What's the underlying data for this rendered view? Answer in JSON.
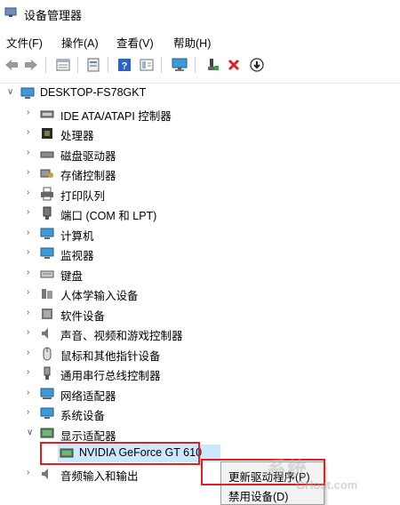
{
  "window": {
    "title": "设备管理器"
  },
  "menu": [
    "文件(F)",
    "操作(A)",
    "查看(V)",
    "帮助(H)"
  ],
  "toolbar_icons": [
    "back-arrow-icon",
    "forward-arrow-icon",
    "properties-icon",
    "show-hide-icon",
    "help-icon",
    "view-icon",
    "monitor-icon",
    "add-driver-icon",
    "uninstall-x-icon",
    "update-driver-icon"
  ],
  "tree": {
    "root": "DESKTOP-FS78GKT",
    "categories": [
      "IDE ATA/ATAPI 控制器",
      "处理器",
      "磁盘驱动器",
      "存储控制器",
      "打印队列",
      "端口 (COM 和 LPT)",
      "计算机",
      "监视器",
      "键盘",
      "人体学输入设备",
      "软件设备",
      "声音、视频和游戏控制器",
      "鼠标和其他指针设备",
      "通用串行总线控制器",
      "网络适配器",
      "系统设备",
      "显示适配器"
    ],
    "expanded_child": "NVIDIA GeForce GT 610",
    "after": "音频输入和输出"
  },
  "context_menu": [
    "更新驱动程序(P)",
    "禁用设备(D)"
  ],
  "watermark": {
    "line1": "系统",
    "line2": "GHost.com"
  }
}
